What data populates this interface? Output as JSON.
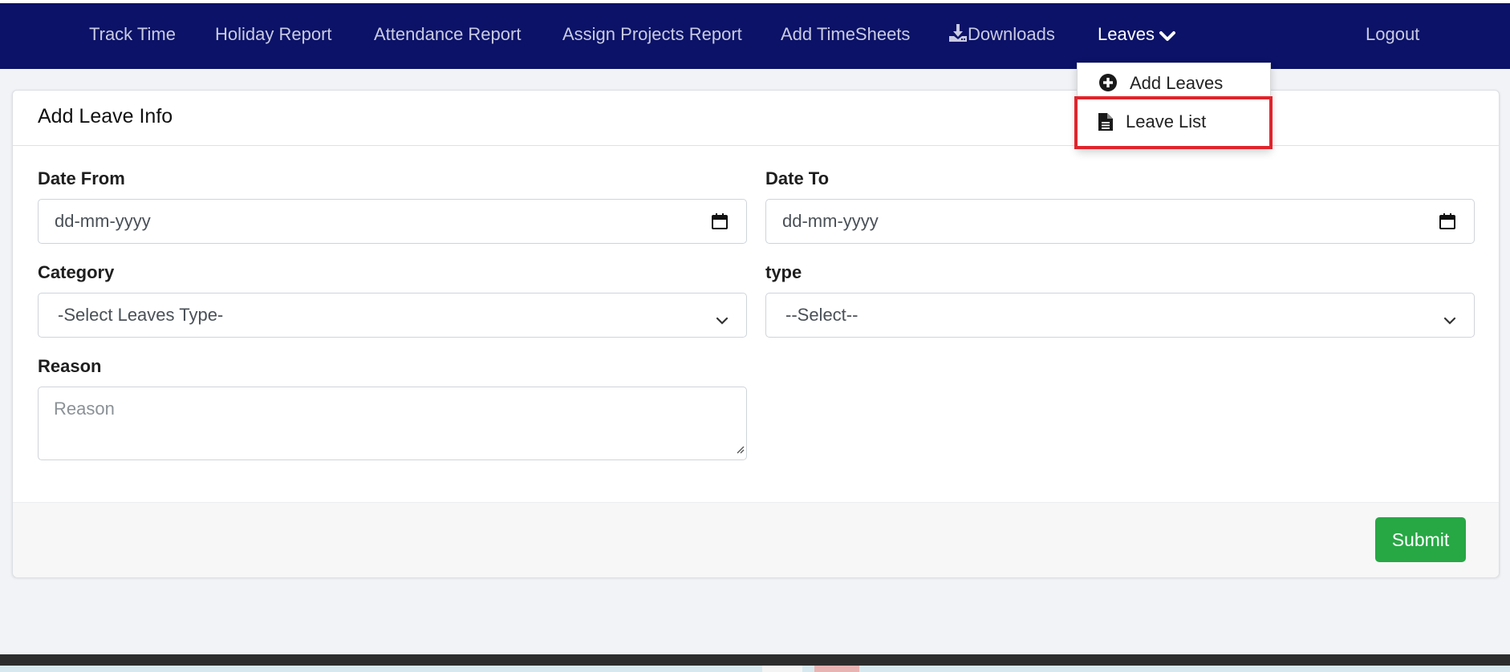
{
  "nav": {
    "items": [
      {
        "label": "Track Time"
      },
      {
        "label": "Holiday Report"
      },
      {
        "label": "Attendance Report"
      },
      {
        "label": "Assign Projects Report"
      },
      {
        "label": "Add TimeSheets"
      },
      {
        "label": "Downloads",
        "icon": "download-icon"
      },
      {
        "label": "Leaves",
        "icon": "chevron-down-icon",
        "active": true
      }
    ],
    "logout": "Logout"
  },
  "dropdown": {
    "items": [
      {
        "label": "Add Leaves",
        "icon": "plus-circle-icon"
      },
      {
        "label": "Leave List",
        "icon": "document-icon",
        "highlighted": true
      }
    ]
  },
  "form": {
    "title": "Add Leave Info",
    "date_from": {
      "label": "Date From",
      "placeholder": "dd-mm-yyyy",
      "icon": "calendar-icon"
    },
    "date_to": {
      "label": "Date To",
      "placeholder": "dd-mm-yyyy",
      "icon": "calendar-icon"
    },
    "category": {
      "label": "Category",
      "value": "-Select Leaves Type-",
      "icon": "chevron-down-icon"
    },
    "type": {
      "label": "type",
      "value": "--Select--",
      "icon": "chevron-down-icon"
    },
    "reason": {
      "label": "Reason",
      "placeholder": "Reason"
    },
    "submit": "Submit"
  },
  "colors": {
    "navbar": "#0b1267",
    "submit": "#28a745",
    "highlight": "#e0242b"
  }
}
